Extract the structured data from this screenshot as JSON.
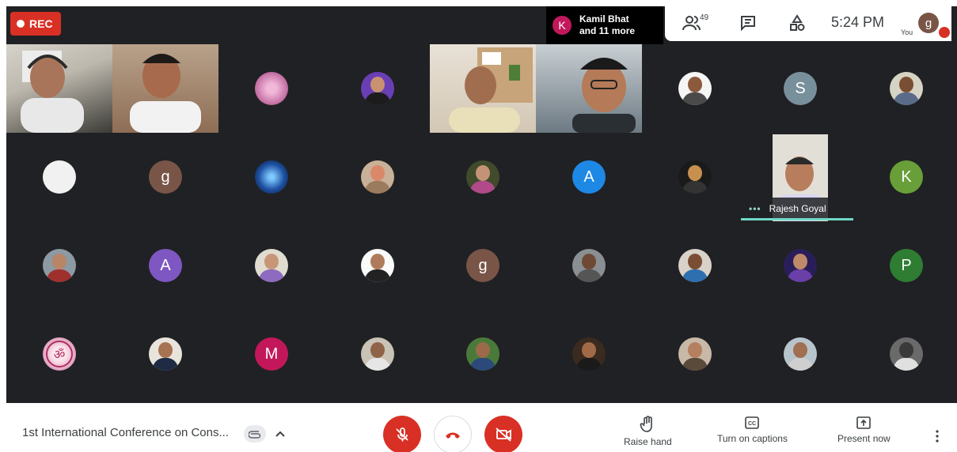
{
  "recording": {
    "label": "REC"
  },
  "active_speaker": {
    "initial": "K",
    "line1": "Kamil Bhat",
    "line2": "and 11 more"
  },
  "top_controls": {
    "participant_count": "49",
    "time": "5:24 PM",
    "self_label": "You",
    "self_initial": "g"
  },
  "participants": {
    "video_tiles": [
      "vt1",
      "vt2",
      "vt3",
      "vt4",
      "vt5"
    ],
    "letter_avatars": [
      {
        "id": "s",
        "letter": "S",
        "color": "#78909c"
      },
      {
        "id": "g1",
        "letter": "g",
        "color": "#795548"
      },
      {
        "id": "a1",
        "letter": "A",
        "color": "#1e88e5"
      },
      {
        "id": "k",
        "letter": "K",
        "color": "#689f38"
      },
      {
        "id": "a2",
        "letter": "A",
        "color": "#7e57c2"
      },
      {
        "id": "g2",
        "letter": "g",
        "color": "#795548"
      },
      {
        "id": "p",
        "letter": "P",
        "color": "#2e7d32"
      },
      {
        "id": "m",
        "letter": "M",
        "color": "#c2185b"
      }
    ],
    "named_tile": {
      "name": "Rajesh Goyal",
      "speaking_indicator": "•••"
    }
  },
  "bottom_bar": {
    "meeting_title": "1st International Conference on Cons...",
    "actions": {
      "raise_hand": "Raise hand",
      "captions": "Turn on captions",
      "present": "Present now"
    }
  },
  "colors": {
    "grid_bg": "#202124",
    "danger": "#d93025",
    "speaking_accent": "#6fd9c7"
  }
}
